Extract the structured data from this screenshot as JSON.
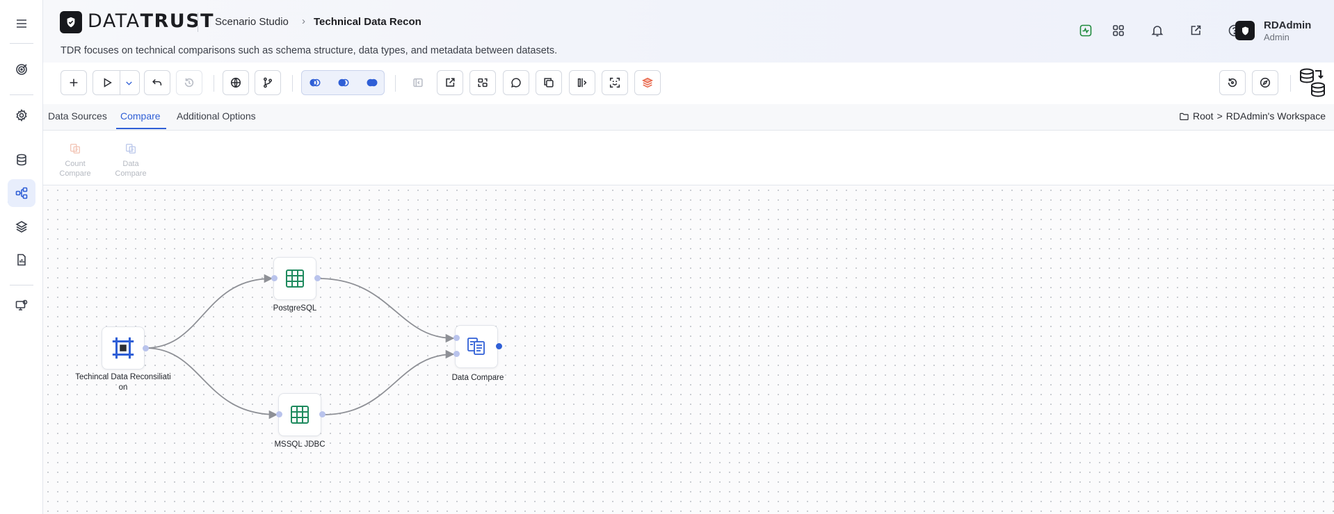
{
  "app": {
    "logo_part1": "DATA",
    "logo_part2": "TRUST"
  },
  "header": {
    "breadcrumb_parent": "Scenario Studio",
    "breadcrumb_current": "Technical Data Recon",
    "description": "TDR focuses on technical comparisons such as schema structure, data types, and metadata between datasets."
  },
  "user": {
    "name": "RDAdmin",
    "role": "Admin"
  },
  "tabs": [
    {
      "label": "Data Sources"
    },
    {
      "label": "Compare"
    },
    {
      "label": "Additional Options"
    }
  ],
  "workspace": {
    "root": "Root",
    "separator": ">",
    "name": "RDAdmin's Workspace"
  },
  "palette": [
    {
      "label_line1": "Count",
      "label_line2": "Compare"
    },
    {
      "label_line1": "Data",
      "label_line2": "Compare"
    }
  ],
  "nodes": {
    "source_line1": "Techincal Data Reconsiliati",
    "source_line2": "on",
    "postgres": "PostgreSQL",
    "mssql": "MSSQL JDBC",
    "compare": "Data Compare"
  },
  "colors": {
    "accent": "#2f5fd6",
    "table_icon": "#1e8a5e",
    "status_green": "#1e8a3c",
    "layers_orange": "#e8664a"
  }
}
